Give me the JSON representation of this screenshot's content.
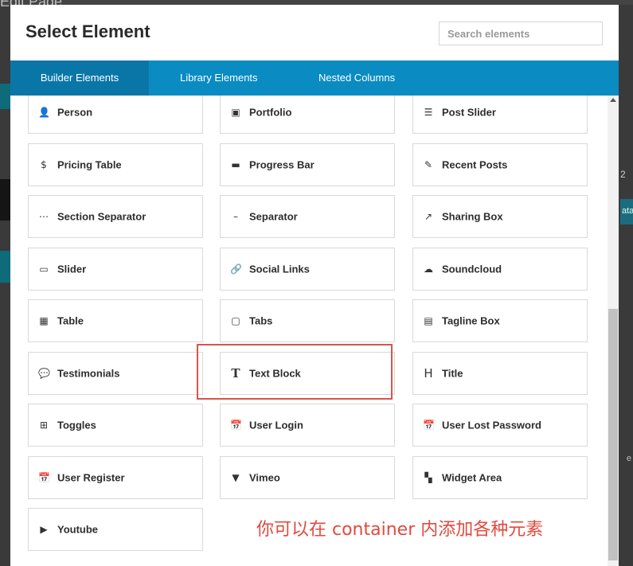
{
  "background": {
    "title_fragment": "Edit Page",
    "right_fragment": "2",
    "right_chip": "ata",
    "right_char": "e"
  },
  "modal": {
    "title": "Select Element",
    "search_placeholder": "Search elements"
  },
  "tabs": [
    {
      "label": "Builder Elements",
      "active": true
    },
    {
      "label": "Library Elements",
      "active": false
    },
    {
      "label": "Nested Columns",
      "active": false
    }
  ],
  "elements": [
    {
      "label": "Person",
      "icon": "person-icon",
      "glyph": "👤"
    },
    {
      "label": "Portfolio",
      "icon": "portfolio-icon",
      "glyph": "▣"
    },
    {
      "label": "Post Slider",
      "icon": "post-slider-icon",
      "glyph": "☰"
    },
    {
      "label": "Pricing Table",
      "icon": "dollar-icon",
      "glyph": "$"
    },
    {
      "label": "Progress Bar",
      "icon": "progress-bar-icon",
      "glyph": "▬"
    },
    {
      "label": "Recent Posts",
      "icon": "feather-icon",
      "glyph": "✎"
    },
    {
      "label": "Section Separator",
      "icon": "ellipsis-icon",
      "glyph": "⋯"
    },
    {
      "label": "Separator",
      "icon": "dash-icon",
      "glyph": "–"
    },
    {
      "label": "Sharing Box",
      "icon": "share-icon",
      "glyph": "↗"
    },
    {
      "label": "Slider",
      "icon": "slider-icon",
      "glyph": "▭"
    },
    {
      "label": "Social Links",
      "icon": "link-icon",
      "glyph": "🔗"
    },
    {
      "label": "Soundcloud",
      "icon": "soundcloud-icon",
      "glyph": "☁"
    },
    {
      "label": "Table",
      "icon": "table-icon",
      "glyph": "▦"
    },
    {
      "label": "Tabs",
      "icon": "folder-icon",
      "glyph": "▢"
    },
    {
      "label": "Tagline Box",
      "icon": "tagline-box-icon",
      "glyph": "▤"
    },
    {
      "label": "Testimonials",
      "icon": "speech-bubble-icon",
      "glyph": "💬"
    },
    {
      "label": "Text Block",
      "icon": "text-icon",
      "glyph": "T"
    },
    {
      "label": "Title",
      "icon": "heading-icon",
      "glyph": "H"
    },
    {
      "label": "Toggles",
      "icon": "plus-square-icon",
      "glyph": "⊞"
    },
    {
      "label": "User Login",
      "icon": "calendar-check-icon",
      "glyph": "📅"
    },
    {
      "label": "User Lost Password",
      "icon": "calendar-check-icon",
      "glyph": "📅"
    },
    {
      "label": "User Register",
      "icon": "calendar-check-icon",
      "glyph": "📅"
    },
    {
      "label": "Vimeo",
      "icon": "vimeo-icon",
      "glyph": "▼"
    },
    {
      "label": "Widget Area",
      "icon": "widget-icon",
      "glyph": "▚"
    },
    {
      "label": "Youtube",
      "icon": "youtube-icon",
      "glyph": "▶"
    }
  ],
  "annotation": "你可以在 container 内添加各种元素",
  "colors": {
    "tab_bar": "#0a8bc2",
    "tab_active": "#0a76a8",
    "highlight": "#d9534f",
    "annotation": "#e04a3f"
  }
}
